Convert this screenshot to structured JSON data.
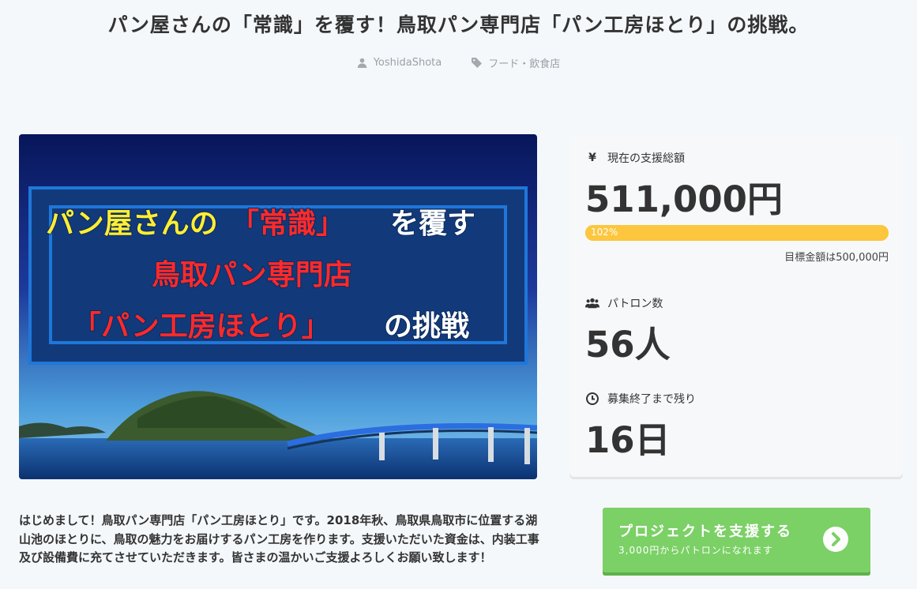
{
  "title": "パン屋さんの「常識」を覆す！鳥取パン専門店「パン工房ほとり」の挑戦。",
  "meta": {
    "author": "YoshidaShota",
    "category": "フード・飲食店"
  },
  "hero": {
    "line1a": "パン屋さんの",
    "line1b": "「常識」",
    "line1c": "を覆す",
    "line2": "鳥取パン専門店",
    "line3a": "「パン工房ほとり」",
    "line3b": "の挑戦"
  },
  "stats": {
    "amount_icon": "¥",
    "amount_label": "現在の支援総額",
    "amount_value": "511,000円",
    "progress_text": "102%",
    "progress_ratio": 1.02,
    "goal_text": "目標金額は500,000円",
    "patrons_label": "パトロン数",
    "patrons_value": "56人",
    "remaining_label": "募集終了まで残り",
    "remaining_value": "16日"
  },
  "description": "はじめまして！鳥取パン専門店「パン工房ほとり」です。2018年秋、鳥取県鳥取市に位置する湖山池のほとりに、鳥取の魅力をお届けするパン工房を作ります。支援いただいた資金は、内装工事及び設備費に充てさせていただきます。皆さまの温かいご支援よろしくお願い致します！",
  "button": {
    "main": "プロジェクトを支援する",
    "sub": "3,000円からパトロンになれます"
  },
  "colors": {
    "progress": "#fcc63e",
    "button": "#7bd066",
    "hero_yellow": "#ffee33",
    "hero_red": "#ff2a2a"
  }
}
